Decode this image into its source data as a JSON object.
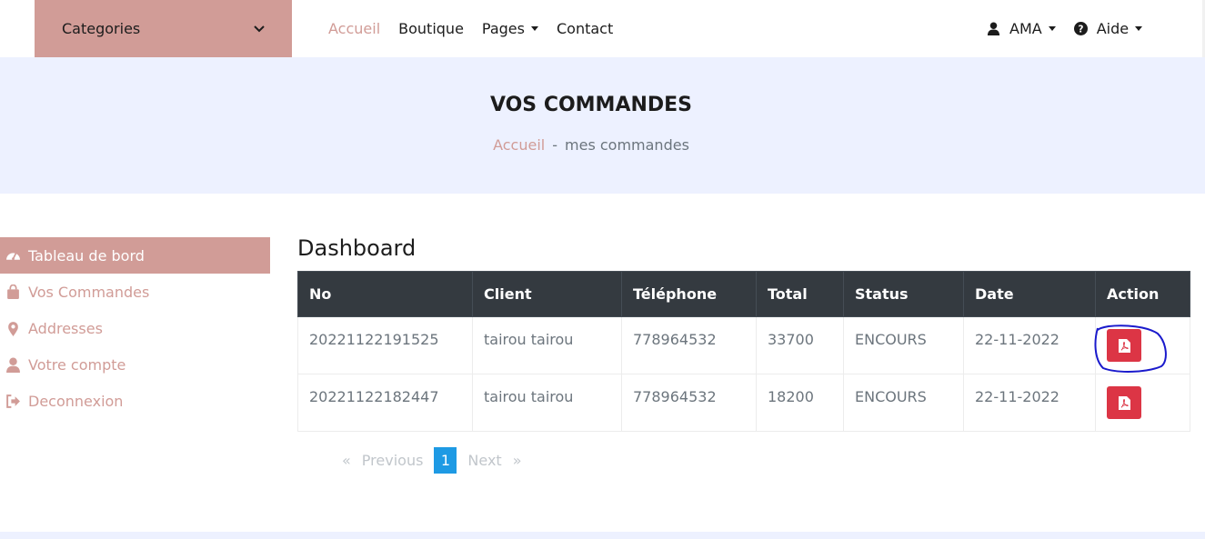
{
  "navbar": {
    "categories_label": "Categories",
    "links": [
      "Accueil",
      "Boutique",
      "Pages",
      "Contact"
    ],
    "user_label": "AMA",
    "help_label": "Aide"
  },
  "header": {
    "title": "VOS COMMANDES",
    "breadcrumb_home": "Accueil",
    "breadcrumb_sep": "-",
    "breadcrumb_current": "mes commandes"
  },
  "sidebar": {
    "items": [
      {
        "label": "Tableau de bord",
        "icon": "dashboard-icon"
      },
      {
        "label": "Vos Commandes",
        "icon": "shopping-bag-icon"
      },
      {
        "label": "Addresses",
        "icon": "map-marker-icon"
      },
      {
        "label": "Votre compte",
        "icon": "user-icon"
      },
      {
        "label": "Deconnexion",
        "icon": "sign-out-icon"
      }
    ]
  },
  "main": {
    "title": "Dashboard",
    "columns": [
      "No",
      "Client",
      "Téléphone",
      "Total",
      "Status",
      "Date",
      "Action"
    ],
    "rows": [
      [
        "20221122191525",
        "tairou tairou",
        "778964532",
        "33700",
        "ENCOURS",
        "22-11-2022"
      ],
      [
        "20221122182447",
        "tairou tairou",
        "778964532",
        "18200",
        "ENCOURS",
        "22-11-2022"
      ]
    ]
  },
  "pagination": {
    "prev_arrow": "«",
    "prev": "Previous",
    "current": "1",
    "next": "Next",
    "next_arrow": "»"
  },
  "colors": {
    "accent": "#d19c97",
    "header_bg": "#edf1ff",
    "table_header": "#343a40",
    "pdf_button": "#dc3545",
    "page_active": "#1e9ae4",
    "annotation": "#1a1acc"
  }
}
